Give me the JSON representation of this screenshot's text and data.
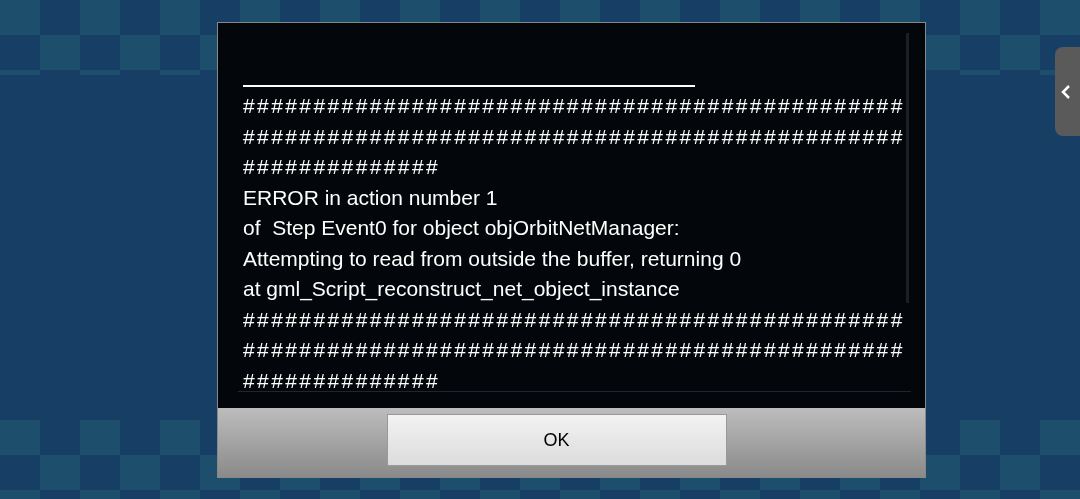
{
  "dialog": {
    "message_lines": [
      "###############################################",
      "###############################################",
      "##############",
      "ERROR in action number 1",
      "of  Step Event0 for object objOrbitNetManager:",
      "Attempting to read from outside the buffer, returning 0",
      "at gml_Script_reconstruct_net_object_instance",
      "###############################################",
      "###############################################",
      "##############"
    ],
    "buttons": [
      {
        "label": "OK"
      }
    ]
  }
}
